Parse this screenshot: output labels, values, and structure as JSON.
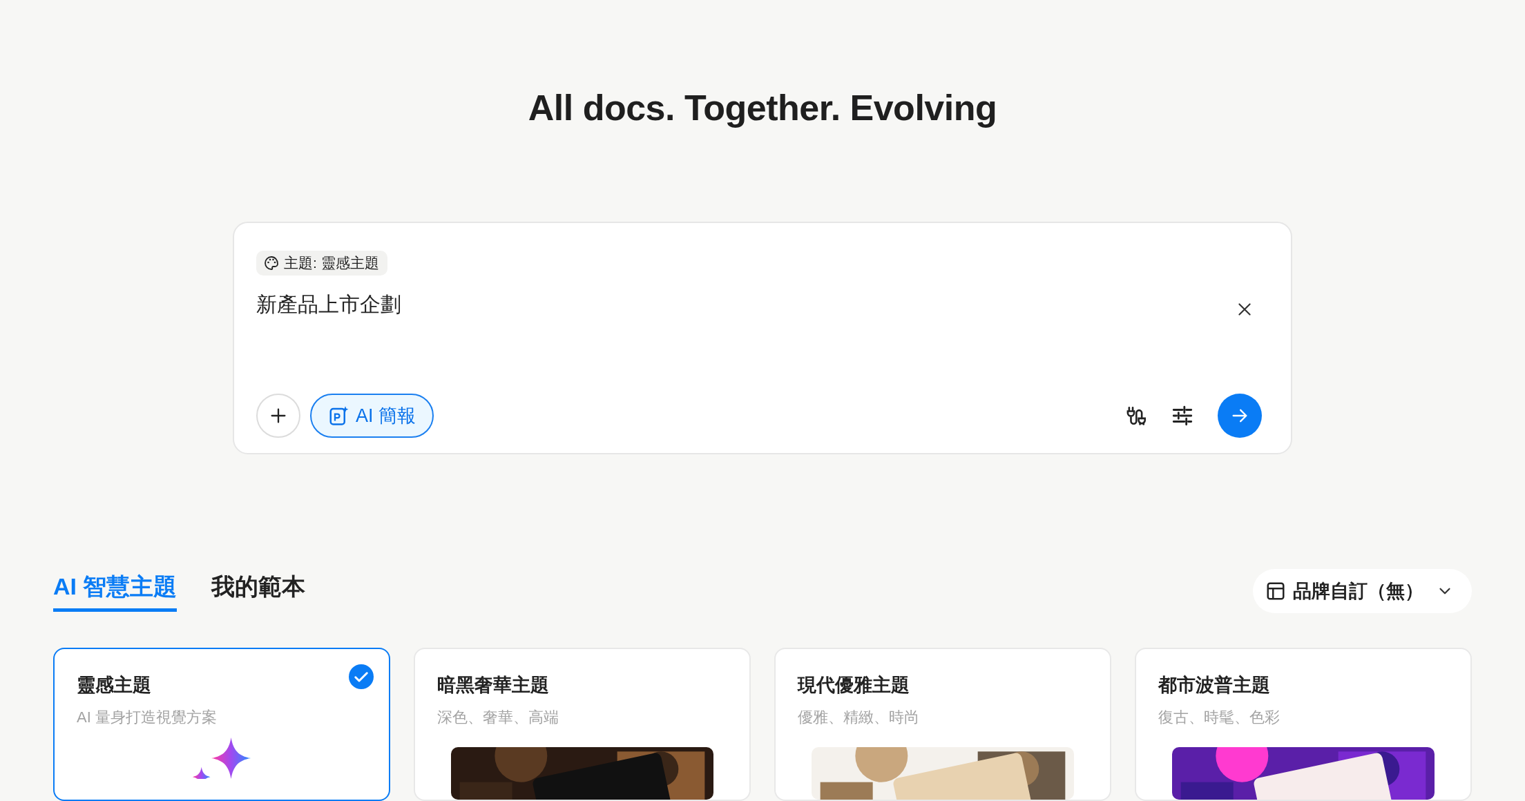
{
  "heading": "All docs. Together. Evolving",
  "prompt": {
    "theme_chip": "主題: 靈感主題",
    "value": "新產品上市企劃",
    "ai_button": "AI 簡報"
  },
  "tabs": [
    {
      "label": "AI 智慧主題",
      "selected": true
    },
    {
      "label": "我的範本",
      "selected": false
    }
  ],
  "brand_dropdown": {
    "label": "品牌自訂（無）"
  },
  "themes": [
    {
      "title": "靈感主題",
      "subtitle": "AI 量身打造視覺方案",
      "kind": "ai",
      "selected": true
    },
    {
      "title": "暗黑奢華主題",
      "subtitle": "深色、奢華、高端",
      "kind": "picture",
      "selected": false
    },
    {
      "title": "現代優雅主題",
      "subtitle": "優雅、精緻、時尚",
      "kind": "picture",
      "selected": false
    },
    {
      "title": "都市波普主題",
      "subtitle": "復古、時髦、色彩",
      "kind": "picture",
      "selected": false
    }
  ]
}
